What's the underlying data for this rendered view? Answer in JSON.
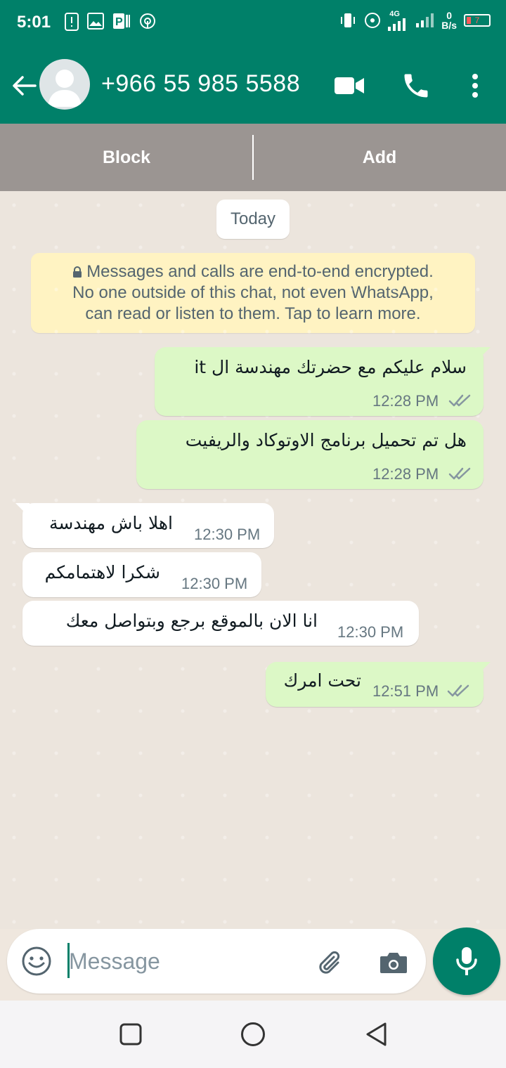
{
  "status_bar": {
    "time": "5:01",
    "network_label": "4G",
    "speed_value": "0",
    "speed_unit": "B/s",
    "battery": "7"
  },
  "app_bar": {
    "title": "+966 55 985 5588",
    "icons": [
      "back-arrow-icon",
      "avatar",
      "video-call-icon",
      "voice-call-icon",
      "more-vert-icon"
    ]
  },
  "actions": {
    "block_label": "Block",
    "add_label": "Add"
  },
  "chat": {
    "date_label": "Today",
    "encryption_line1": "Messages and calls are end-to-end encrypted.",
    "encryption_line2": "No one outside of this chat, not even WhatsApp,",
    "encryption_line3": "can read or listen to them. Tap to learn more.",
    "messages": [
      {
        "direction": "out",
        "text": "سلام عليكم مع حضرتك مهندسة ال it",
        "time": "12:28 PM",
        "status": "read"
      },
      {
        "direction": "out",
        "text": "هل تم تحميل برنامج الاوتوكاد والريفيت",
        "time": "12:28 PM",
        "status": "read"
      },
      {
        "direction": "in",
        "text": "اهلا باش مهندسة",
        "time": "12:30 PM"
      },
      {
        "direction": "in",
        "text": "شكرا لاهتمامكم",
        "time": "12:30 PM"
      },
      {
        "direction": "in",
        "text": "انا الان بالموقع برجع وبتواصل معك",
        "time": "12:30 PM"
      },
      {
        "direction": "out",
        "text": "تحت امرك",
        "time": "12:51 PM",
        "status": "read"
      }
    ]
  },
  "input": {
    "placeholder": "Message"
  },
  "colors": {
    "header": "#008069",
    "outgoing_bubble": "#dcf8c6",
    "incoming_bubble": "#ffffff",
    "mic_button": "#008069",
    "chat_background": "#ece5dd"
  }
}
